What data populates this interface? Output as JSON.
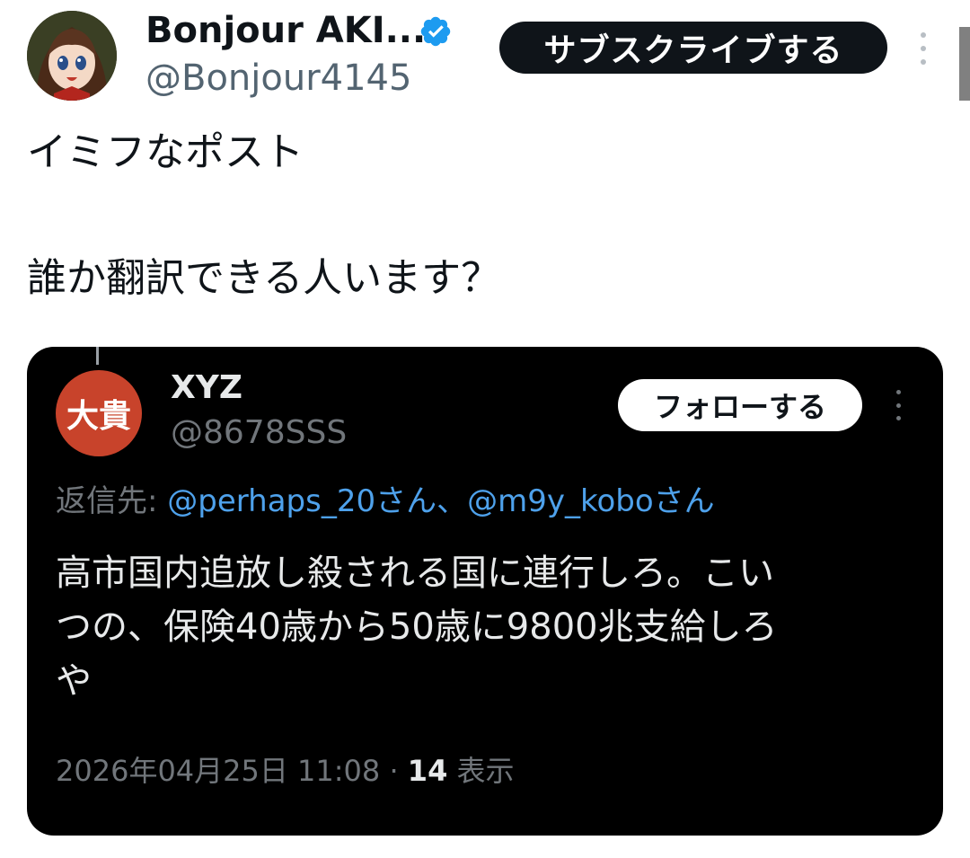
{
  "author": {
    "display_name": "Bonjour AKI...",
    "handle": "@Bonjour4145",
    "subscribe_label": "サブスクライブする"
  },
  "post": {
    "line1": "イミフなポスト",
    "line2": "誰か翻訳できる人います？"
  },
  "embedded_reply": {
    "avatar_text": "大貴",
    "name": "XYZ",
    "handle": "@8678SSS",
    "follow_label": "フォローする",
    "reply_to_prefix": "返信先: ",
    "mention_1": "@perhaps_20さん",
    "mention_sep": "、",
    "mention_2": "@m9y_koboさん",
    "body_line1": "高市国内追放し殺される国に連行しろ。こい",
    "body_line2": "つの、保険40歳から50歳に9800兆支給しろ",
    "body_line3": "や",
    "timestamp": "2026年04月25日 11:08 · ",
    "view_count": "14",
    "view_label": " 表示"
  },
  "colors": {
    "verified": "#1d9bf0",
    "mention": "#4ea1eb",
    "inner_avatar_bg": "#c8432b"
  },
  "icons": {
    "verified": "verified-badge-icon",
    "more": "more-vertical-icon"
  }
}
